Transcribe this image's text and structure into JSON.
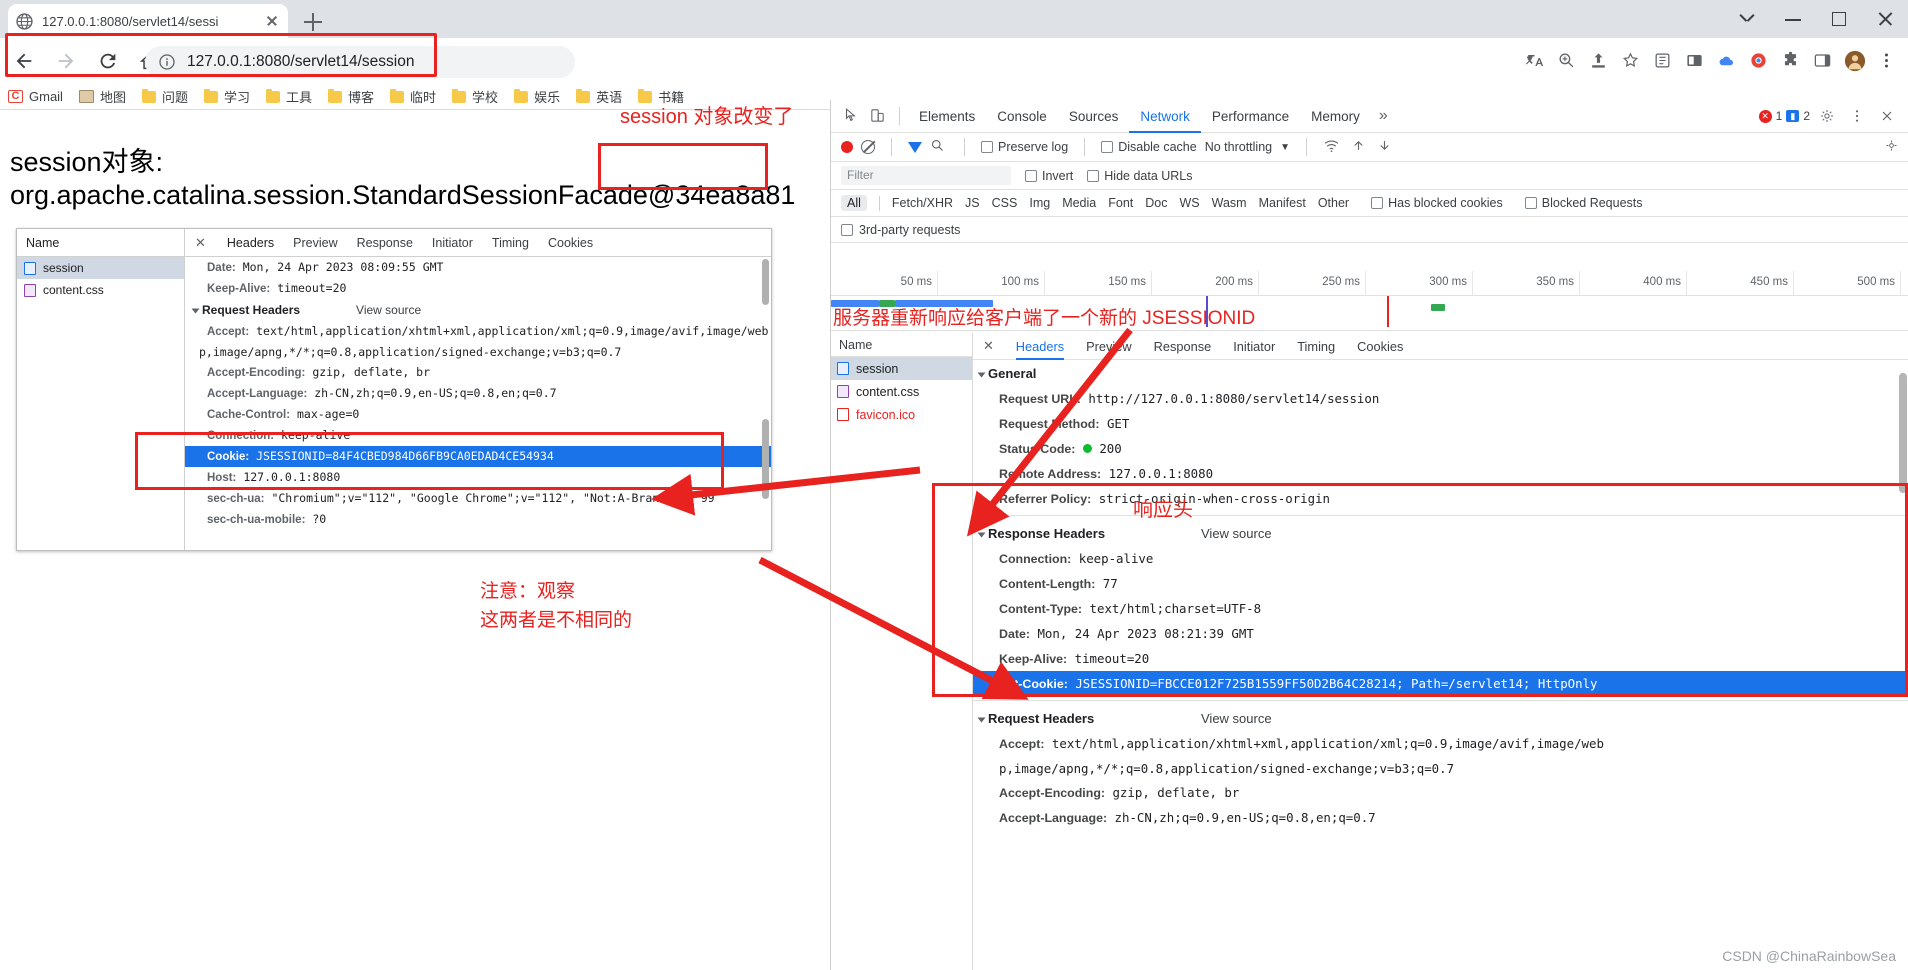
{
  "browser": {
    "tab_title": "127.0.0.1:8080/servlet14/sessi",
    "url": "127.0.0.1:8080/servlet14/session",
    "bookmarks": [
      {
        "label": "Gmail",
        "icon": "gmail-icon"
      },
      {
        "label": "地图",
        "icon": "map-icon"
      },
      {
        "label": "问题",
        "icon": "folder-icon"
      },
      {
        "label": "学习",
        "icon": "folder-icon"
      },
      {
        "label": "工具",
        "icon": "folder-icon"
      },
      {
        "label": "博客",
        "icon": "folder-icon"
      },
      {
        "label": "临时",
        "icon": "folder-icon"
      },
      {
        "label": "学校",
        "icon": "folder-icon"
      },
      {
        "label": "娱乐",
        "icon": "folder-icon"
      },
      {
        "label": "英语",
        "icon": "folder-icon"
      },
      {
        "label": "书籍",
        "icon": "folder-icon"
      }
    ]
  },
  "page": {
    "line1": "session对象:",
    "line2": "org.apache.catalina.session.StandardSessionFacade@34ea8a81"
  },
  "annotations": {
    "a1": "session 对象改变了",
    "a2": "服务器重新响应给客户端了一个新的 JSESSIONID",
    "a3_line1": "注意：观察",
    "a3_line2": "这两者是不相同的",
    "a4": "响应头",
    "color": "#e8221f"
  },
  "screenshot_devtools": {
    "name_header": "Name",
    "rows": [
      {
        "label": "session",
        "icon": "doc-icon"
      },
      {
        "label": "content.css",
        "icon": "css-icon"
      }
    ],
    "tabs": [
      "Headers",
      "Preview",
      "Response",
      "Initiator",
      "Timing",
      "Cookies"
    ],
    "active_tab": "Headers",
    "lines": [
      {
        "type": "plain",
        "name": "Date:",
        "value": "Mon, 24 Apr 2023 08:09:55 GMT"
      },
      {
        "type": "plain",
        "name": "Keep-Alive:",
        "value": "timeout=20"
      },
      {
        "type": "section",
        "name": "Request Headers",
        "view_source": "View source"
      },
      {
        "type": "plain",
        "name": "Accept:",
        "value": "text/html,application/xhtml+xml,application/xml;q=0.9,image/avif,image/web"
      },
      {
        "type": "cont",
        "name": "",
        "value": "p,image/apng,*/*;q=0.8,application/signed-exchange;v=b3;q=0.7"
      },
      {
        "type": "plain",
        "name": "Accept-Encoding:",
        "value": "gzip, deflate, br"
      },
      {
        "type": "plain",
        "name": "Accept-Language:",
        "value": "zh-CN,zh;q=0.9,en-US;q=0.8,en;q=0.7"
      },
      {
        "type": "plain",
        "name": "Cache-Control:",
        "value": "max-age=0"
      },
      {
        "type": "plain",
        "name": "Connection:",
        "value": "keep-alive"
      },
      {
        "type": "selected",
        "name": "Cookie:",
        "value": "JSESSIONID=84F4CBED984D66FB9CA0EDAD4CE54934"
      },
      {
        "type": "plain",
        "name": "Host:",
        "value": "127.0.0.1:8080"
      },
      {
        "type": "plain",
        "name": "sec-ch-ua:",
        "value": "\"Chromium\";v=\"112\", \"Google Chrome\";v=\"112\", \"Not:A-Brand\";v=\"99"
      },
      {
        "type": "plain",
        "name": "sec-ch-ua-mobile:",
        "value": "?0"
      }
    ]
  },
  "devtools": {
    "panels": [
      "Elements",
      "Console",
      "Sources",
      "Network",
      "Performance",
      "Memory"
    ],
    "active_panel": "Network",
    "more_panels_icon": "chevron-double-right-icon",
    "error_count": "1",
    "warning_count": "2",
    "toolbar": {
      "record_icon": "record-icon",
      "clear_icon": "clear-icon",
      "filter_icon": "funnel-icon",
      "search_icon": "search-icon",
      "preserve_log": "Preserve log",
      "disable_cache": "Disable cache",
      "throttling": "No throttling",
      "import_icon": "import-icon",
      "export_icon": "export-icon",
      "wifi_icon": "wifi-icon",
      "settings_icon": "gear-icon",
      "close_icon": "close-icon",
      "menu_icon": "kebab-menu-icon"
    },
    "filter": {
      "placeholder": "Filter",
      "invert": "Invert",
      "hide_data_urls": "Hide data URLs",
      "third_party": "3rd-party requests"
    },
    "types": [
      "All",
      "Fetch/XHR",
      "JS",
      "CSS",
      "Img",
      "Media",
      "Font",
      "Doc",
      "WS",
      "Wasm",
      "Manifest",
      "Other"
    ],
    "active_type": "All",
    "has_blocked_cookies": "Has blocked cookies",
    "blocked_requests": "Blocked Requests",
    "timeline_ticks": [
      "50 ms",
      "100 ms",
      "150 ms",
      "200 ms",
      "250 ms",
      "300 ms",
      "350 ms",
      "400 ms",
      "450 ms",
      "500 ms"
    ],
    "requests_header": "Name",
    "requests": [
      {
        "label": "session",
        "icon": "doc-icon"
      },
      {
        "label": "content.css",
        "icon": "css-icon"
      },
      {
        "label": "favicon.ico",
        "icon": "ico-icon"
      }
    ],
    "detail_tabs": [
      "Headers",
      "Preview",
      "Response",
      "Initiator",
      "Timing",
      "Cookies"
    ],
    "detail_active_tab": "Headers",
    "general": {
      "title": "General",
      "rows": [
        {
          "name": "Request URL:",
          "value": "http://127.0.0.1:8080/servlet14/session"
        },
        {
          "name": "Request Method:",
          "value": "GET"
        },
        {
          "name": "Status Code:",
          "value": "200",
          "status_dot": "#0cbb2f"
        },
        {
          "name": "Remote Address:",
          "value": "127.0.0.1:8080"
        },
        {
          "name": "Referrer Policy:",
          "value": "strict-origin-when-cross-origin"
        }
      ]
    },
    "response_headers": {
      "title": "Response Headers",
      "view_source": "View source",
      "rows": [
        {
          "name": "Connection:",
          "value": "keep-alive"
        },
        {
          "name": "Content-Length:",
          "value": "77"
        },
        {
          "name": "Content-Type:",
          "value": "text/html;charset=UTF-8"
        },
        {
          "name": "Date:",
          "value": "Mon, 24 Apr 2023 08:21:39 GMT"
        },
        {
          "name": "Keep-Alive:",
          "value": "timeout=20"
        },
        {
          "name": "Set-Cookie:",
          "value": "JSESSIONID=FBCCE012F725B1559FF50D2B64C28214; Path=/servlet14; HttpOnly",
          "selected": true
        }
      ]
    },
    "request_headers": {
      "title": "Request Headers",
      "view_source": "View source",
      "rows": [
        {
          "name": "Accept:",
          "value": "text/html,application/xhtml+xml,application/xml;q=0.9,image/avif,image/web"
        },
        {
          "name": "",
          "value": "p,image/apng,*/*;q=0.8,application/signed-exchange;v=b3;q=0.7"
        },
        {
          "name": "Accept-Encoding:",
          "value": "gzip, deflate, br"
        },
        {
          "name": "Accept-Language:",
          "value": "zh-CN,zh;q=0.9,en-US;q=0.8,en;q=0.7"
        }
      ]
    }
  },
  "watermark": "CSDN @ChinaRainbowSea"
}
